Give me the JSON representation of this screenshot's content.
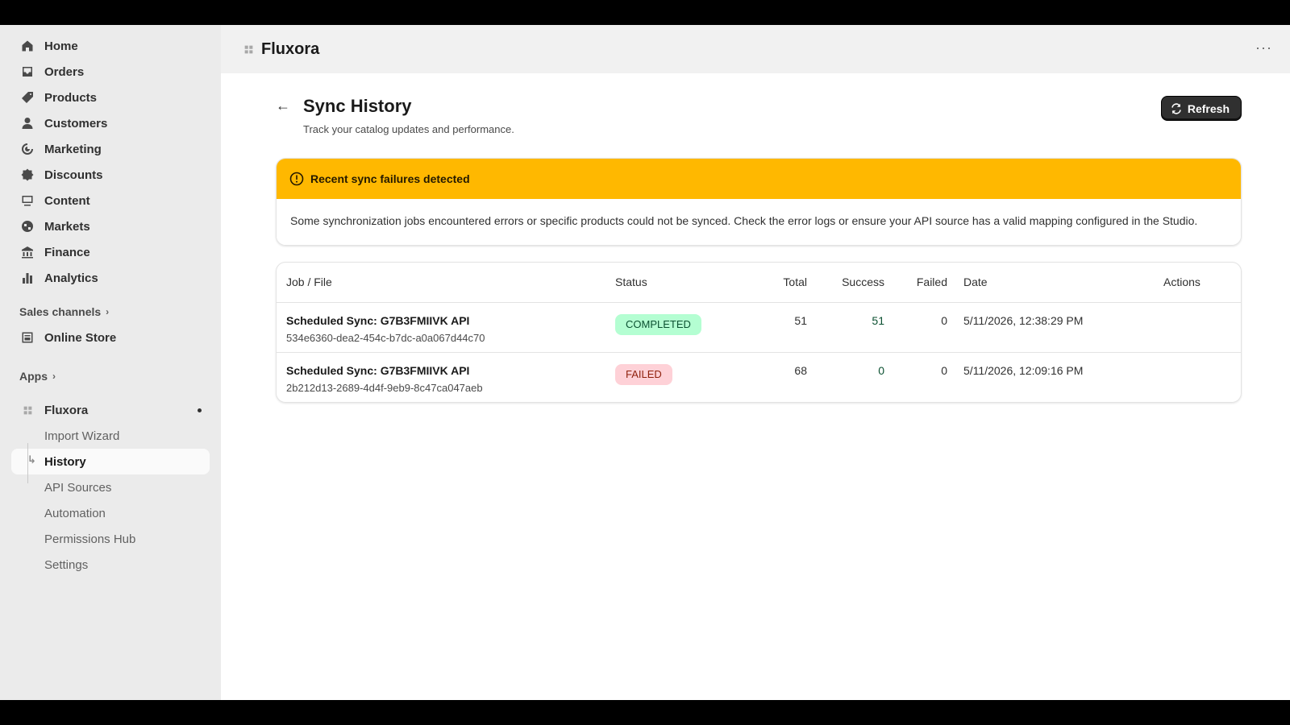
{
  "sidebar": {
    "nav": [
      {
        "label": "Home",
        "icon": "home-icon"
      },
      {
        "label": "Orders",
        "icon": "orders-icon"
      },
      {
        "label": "Products",
        "icon": "tag-icon"
      },
      {
        "label": "Customers",
        "icon": "person-icon"
      },
      {
        "label": "Marketing",
        "icon": "target-icon"
      },
      {
        "label": "Discounts",
        "icon": "discount-icon"
      },
      {
        "label": "Content",
        "icon": "content-icon"
      },
      {
        "label": "Markets",
        "icon": "globe-icon"
      },
      {
        "label": "Finance",
        "icon": "bank-icon"
      },
      {
        "label": "Analytics",
        "icon": "bar-chart-icon"
      }
    ],
    "sales_channels_label": "Sales channels",
    "online_store_label": "Online Store",
    "apps_label": "Apps",
    "app_name": "Fluxora",
    "app_subitems": [
      "Import Wizard",
      "History",
      "API Sources",
      "Automation",
      "Permissions Hub",
      "Settings"
    ],
    "active_subitem": "History"
  },
  "topbar": {
    "app_title": "Fluxora",
    "more_label": "···"
  },
  "page": {
    "back_arrow": "←",
    "title": "Sync History",
    "subtitle": "Track your catalog updates and performance.",
    "refresh_label": "Refresh"
  },
  "banner": {
    "title": "Recent sync failures detected",
    "body": "Some synchronization jobs encountered errors or specific products could not be synced. Check the error logs or ensure your API source has a valid mapping configured in the Studio.",
    "color": "#ffb800"
  },
  "table": {
    "headers": {
      "job": "Job / File",
      "status": "Status",
      "total": "Total",
      "success": "Success",
      "failed": "Failed",
      "date": "Date",
      "actions": "Actions"
    },
    "rows": [
      {
        "name": "Scheduled Sync: G7B3FMIIVK API",
        "id": "534e6360-dea2-454c-b7dc-a0a067d44c70",
        "status": "COMPLETED",
        "total": "51",
        "success": "51",
        "failed": "0",
        "date": "5/11/2026, 12:38:29 PM"
      },
      {
        "name": "Scheduled Sync: G7B3FMIIVK API",
        "id": "2b212d13-2689-4d4f-9eb9-8c47ca047aeb",
        "status": "FAILED",
        "total": "68",
        "success": "0",
        "failed": "0",
        "date": "5/11/2026, 12:09:16 PM"
      }
    ]
  }
}
